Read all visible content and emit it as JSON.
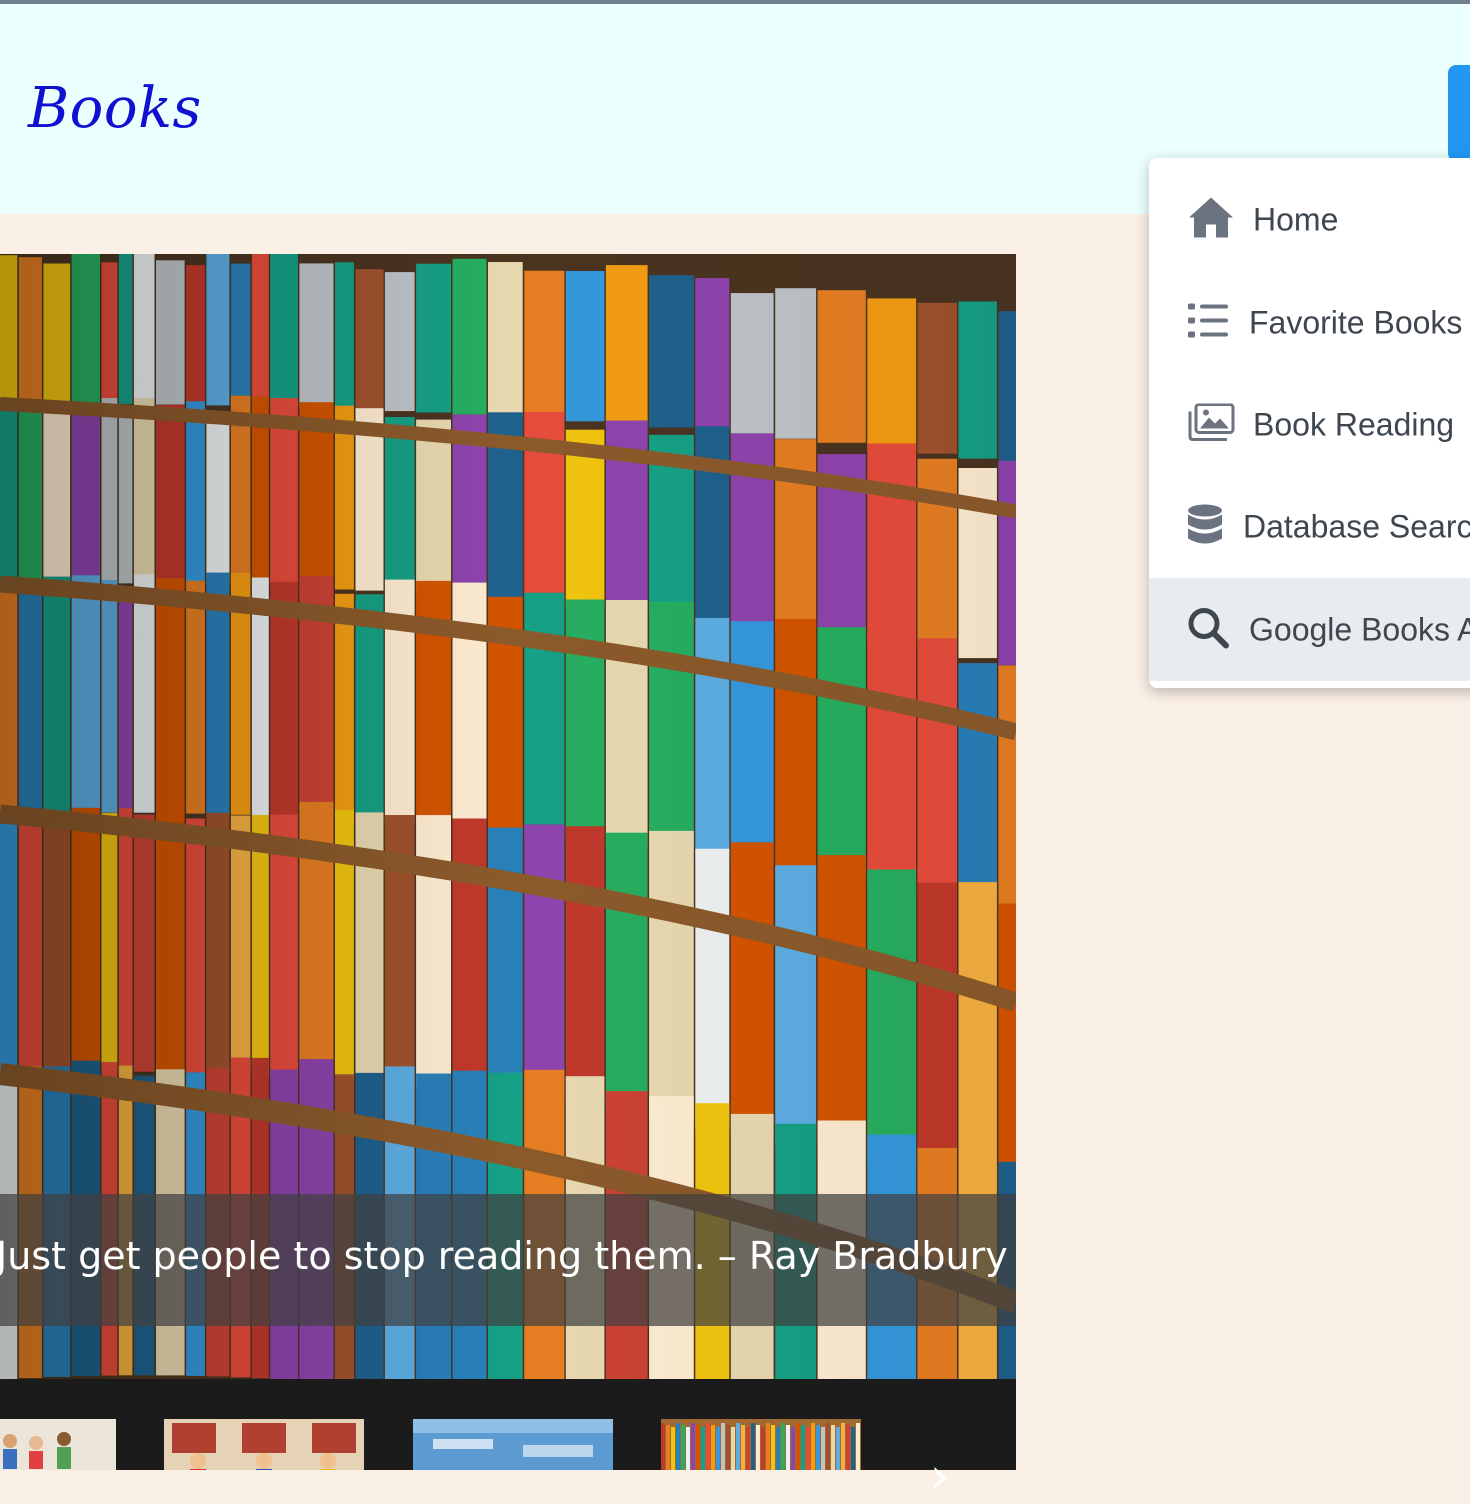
{
  "header": {
    "brand": "Books"
  },
  "menu": {
    "items": [
      {
        "label": "Home",
        "icon": "home-icon"
      },
      {
        "label": "Favorite Books",
        "icon": "list-icon"
      },
      {
        "label": "Book Reading",
        "icon": "images-icon"
      },
      {
        "label": "Database Search",
        "icon": "database-icon"
      },
      {
        "label": "Google Books API",
        "icon": "search-icon"
      }
    ],
    "active_index": 4
  },
  "carousel": {
    "caption": "Just get people to stop reading them. – Ray Bradbury",
    "next_label": "›"
  },
  "colors": {
    "header_bg": "#ebffff",
    "page_bg": "#fbf0e6",
    "brand": "#1010d0",
    "accent": "#2196f3",
    "menu_text": "#3e4650",
    "active_item_bg": "#e9ecef"
  }
}
